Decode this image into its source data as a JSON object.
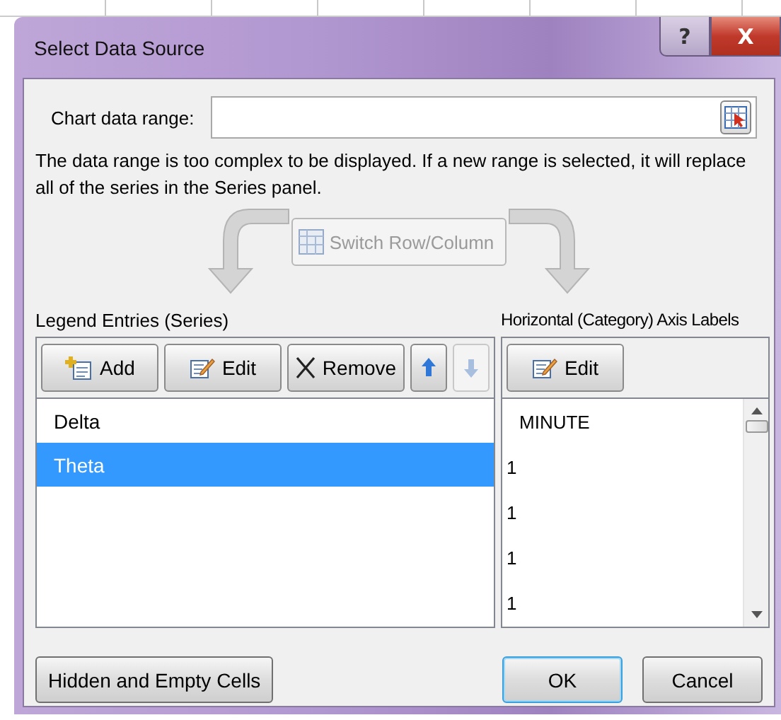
{
  "window": {
    "title": "Select Data Source",
    "buttons": [
      {
        "kind": "help",
        "label": "?"
      },
      {
        "kind": "close",
        "label": "X"
      }
    ]
  },
  "chart_data_range": {
    "label": "Chart data range:"
  },
  "message": "The data range is too complex to be displayed. If a new range is selected, it will replace all of the series in the Series panel.",
  "switch_button": {
    "label": "Switch Row/Column",
    "disabled": true
  },
  "legend_entries": {
    "heading": "Legend Entries (Series)",
    "buttons": [
      {
        "kind": "add",
        "label": "Add",
        "disabled": false
      },
      {
        "kind": "edit",
        "label": "Edit",
        "disabled": false
      },
      {
        "kind": "remove",
        "label": "Remove",
        "disabled": false
      },
      {
        "kind": "up",
        "disabled": false
      },
      {
        "kind": "down",
        "disabled": true
      }
    ],
    "items": [
      {
        "label": "Delta",
        "selected": false
      },
      {
        "label": "Theta",
        "selected": true
      }
    ]
  },
  "axis_labels": {
    "heading": "Horizontal (Category) Axis Labels",
    "edit_button": "Edit",
    "items": [
      "MINUTE",
      "1",
      "1",
      "1",
      "1"
    ]
  },
  "footer": {
    "hidden_cells_button": "Hidden and Empty Cells",
    "ok_button": "OK",
    "cancel_button": "Cancel"
  }
}
